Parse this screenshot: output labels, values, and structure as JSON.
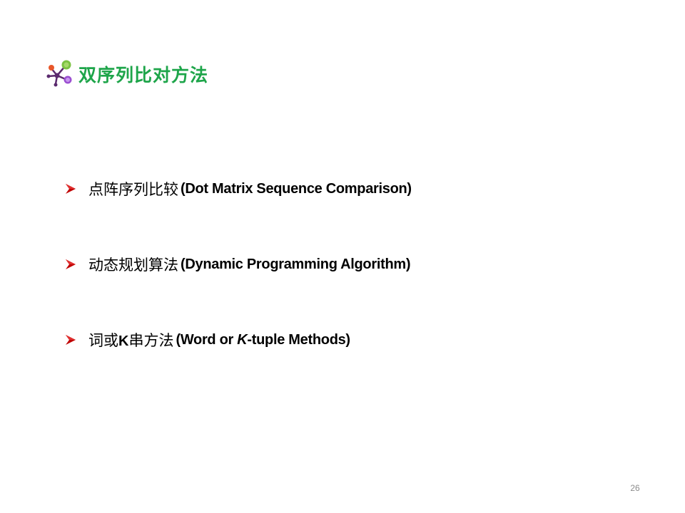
{
  "slide": {
    "title": "双序列比对方法",
    "logo_icon": "molecule-network-icon",
    "bullet_icon": "arrow-bullet-icon",
    "accent_color": "#1ea54a",
    "bullets": [
      {
        "cn": "点阵序列比较",
        "en": "(Dot Matrix Sequence Comparison)"
      },
      {
        "cn": "动态规划算法",
        "en": "(Dynamic Programming Algorithm)"
      },
      {
        "cn_part1": "词或",
        "cn_k": "K",
        "cn_part2": "串方法",
        "en_open": "(Word or ",
        "en_k": "K",
        "en_rest": "-tuple Methods)"
      }
    ],
    "page_number": "26"
  }
}
